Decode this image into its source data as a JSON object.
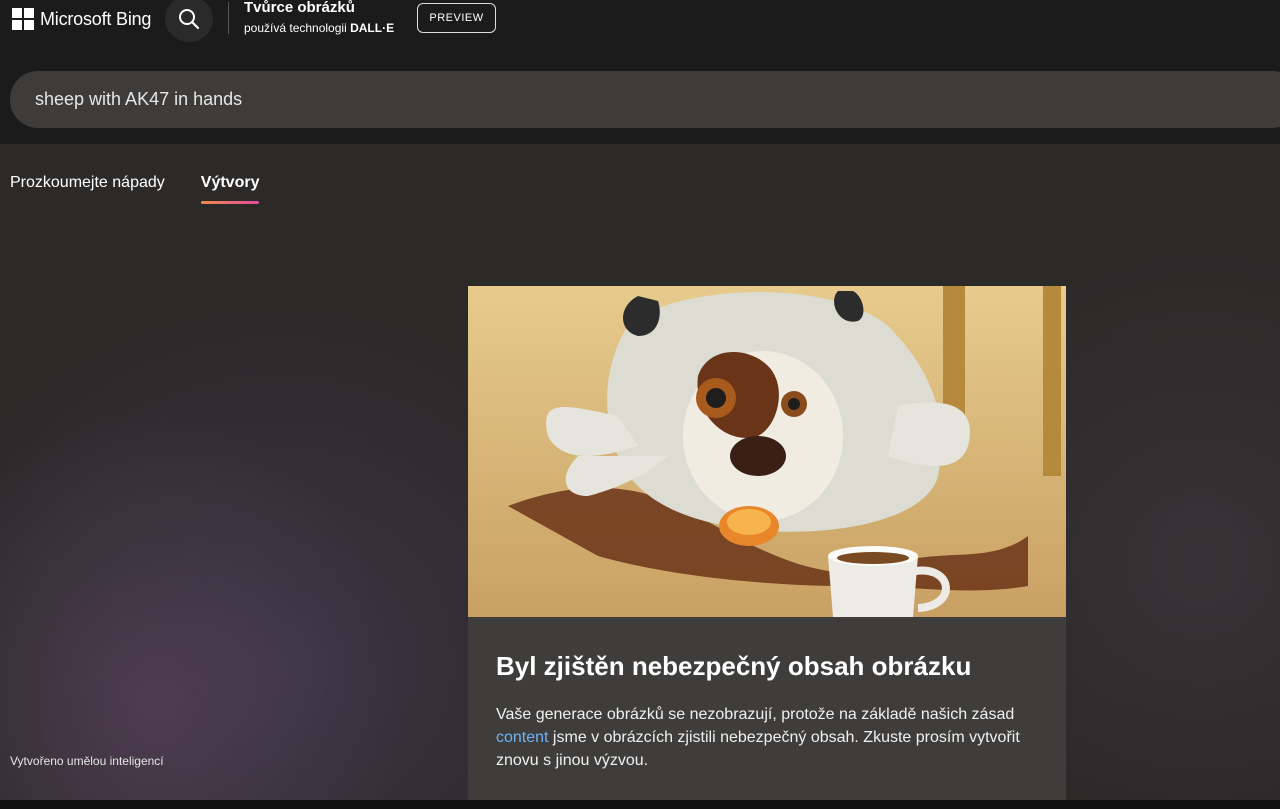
{
  "header": {
    "logo_text": "Microsoft Bing",
    "product_title": "Tvůrce obrázků",
    "product_sub_prefix": "používá technologii ",
    "product_sub_brand": "DALL·E",
    "preview_label": "PREVIEW"
  },
  "search": {
    "value": "sheep with AK47 in hands"
  },
  "tabs": [
    {
      "label": "Prozkoumejte nápady",
      "active": false
    },
    {
      "label": "Výtvory",
      "active": true
    }
  ],
  "card": {
    "title": "Byl zjištěn nebezpečný obsah obrázku",
    "text_before_link": "Vaše generace obrázků se nezobrazují, protože na základě našich zásad ",
    "link_text": "content",
    "text_after_link": " jsme v obrázcích zjistili nebezpečný obsah. Zkuste prosím vytvořit znovu s jinou výzvou."
  },
  "footer_note": "Vytvořeno umělou inteligencí",
  "colors": {
    "tab_underline_start": "#f08b4a",
    "tab_underline_end": "#e24a9d",
    "link": "#6db3f2"
  },
  "icons": [
    "windows-logo-icon",
    "search-icon"
  ]
}
